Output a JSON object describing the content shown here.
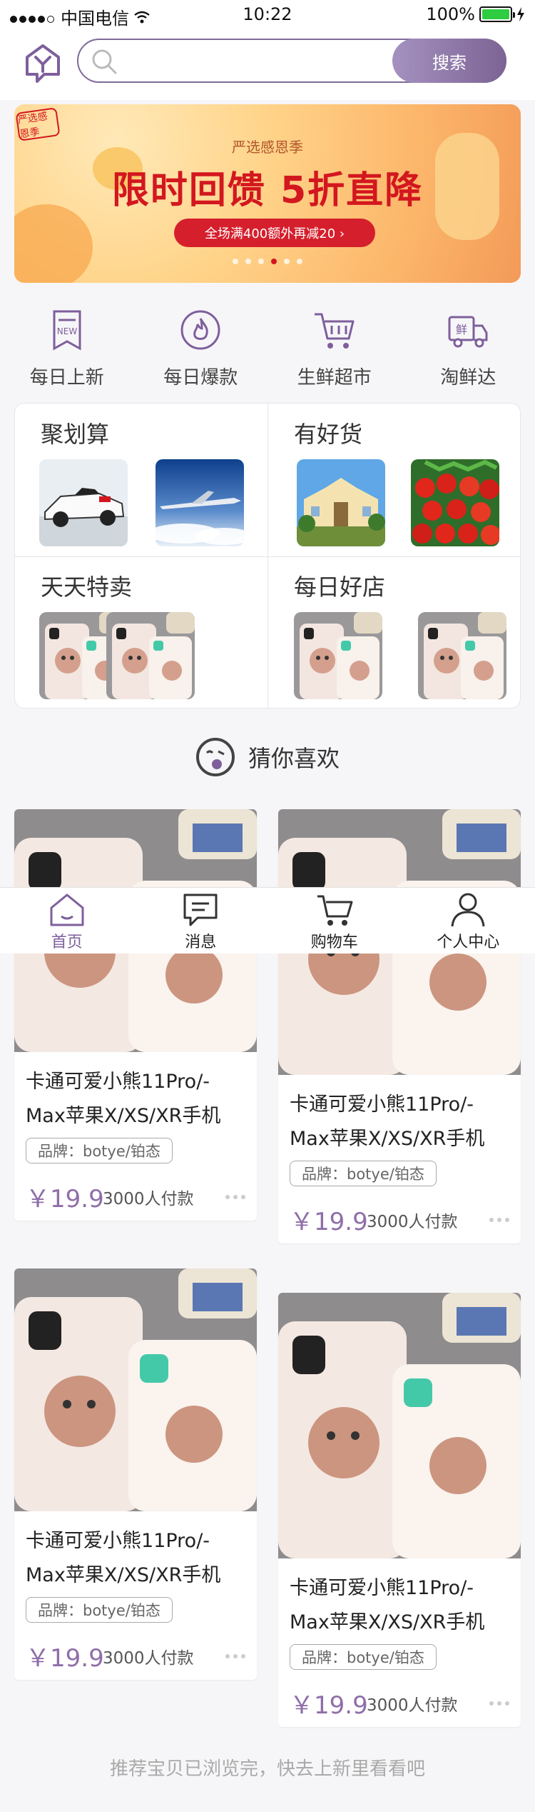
{
  "status_bar": {
    "carrier": "中国电信",
    "time": "10:22",
    "battery": "100%"
  },
  "search": {
    "placeholder": "",
    "button_label": "搜索"
  },
  "banner": {
    "stamp": "严选感恩季",
    "subtitle": "严选感恩季",
    "title": "限时回馈 5折直降",
    "promo": "全场满400额外再减20 ›",
    "slide_count": 6,
    "active_slide": 4
  },
  "categories": [
    {
      "label": "每日上新",
      "icon": "new-icon"
    },
    {
      "label": "每日爆款",
      "icon": "fire-icon"
    },
    {
      "label": "生鲜超市",
      "icon": "cart-icon"
    },
    {
      "label": "淘鲜达",
      "icon": "truck-icon"
    }
  ],
  "sections": [
    {
      "title": "聚划算",
      "images": [
        "race-car-image",
        "airplane-image"
      ]
    },
    {
      "title": "有好货",
      "images": [
        "building-image",
        "tomatoes-image"
      ]
    },
    {
      "title": "天天特卖",
      "images": [
        "phone-case-image",
        "phone-case-image"
      ]
    },
    {
      "title": "每日好店",
      "images": [
        "phone-case-image",
        "phone-case-image"
      ]
    }
  ],
  "guess_title": "猜你喜欢",
  "products": [
    {
      "name": "卡通可爱小熊11Pro/-Max苹果X/XS/XR手机",
      "brand": "品牌：botye/铂态",
      "price": "￥19.9",
      "paid": "3000人付款"
    },
    {
      "name": "卡通可爱小熊11Pro/-Max苹果X/XS/XR手机",
      "brand": "品牌：botye/铂态",
      "price": "￥19.9",
      "paid": "3000人付款"
    },
    {
      "name": "卡通可爱小熊11Pro/-Max苹果X/XS/XR手机",
      "brand": "品牌：botye/铂态",
      "price": "￥19.9",
      "paid": "3000人付款"
    },
    {
      "name": "卡通可爱小熊11Pro/-Max苹果X/XS/XR手机",
      "brand": "品牌：botye/铂态",
      "price": "￥19.9",
      "paid": "3000人付款"
    }
  ],
  "tabbar": [
    {
      "label": "首页",
      "icon": "home-icon",
      "active": true
    },
    {
      "label": "消息",
      "icon": "message-icon",
      "active": false
    },
    {
      "label": "购物车",
      "icon": "cart-icon",
      "active": false
    },
    {
      "label": "个人中心",
      "icon": "user-icon",
      "active": false
    }
  ],
  "footer_text": "推荐宝贝已浏览完，快去上新里看看吧",
  "colors": {
    "accent": "#7e5f9c",
    "price": "#8f6ea8",
    "banner_red": "#d3171f"
  }
}
